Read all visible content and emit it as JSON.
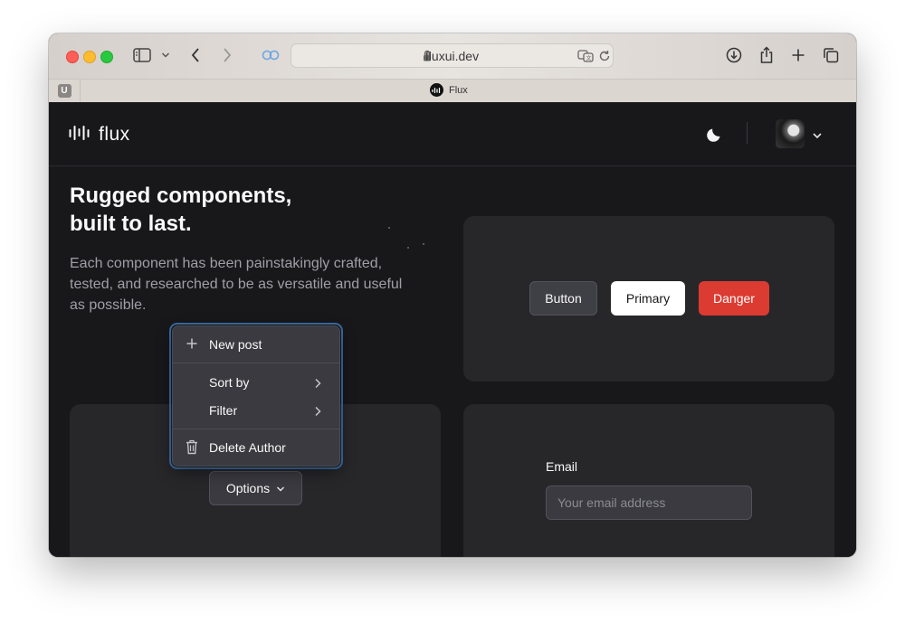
{
  "browser": {
    "url": "fluxui.dev",
    "pinned_tab_letter": "U",
    "tab_title": "Flux"
  },
  "header": {
    "logo_text": "flux"
  },
  "hero": {
    "title_line1": "Rugged components,",
    "title_line2": "built to last.",
    "description": "Each component has been painstakingly crafted, tested, and researched to be as versatile and useful as possible."
  },
  "buttons_card": {
    "default_label": "Button",
    "primary_label": "Primary",
    "danger_label": "Danger"
  },
  "dropdown": {
    "trigger_label": "Options",
    "items": [
      {
        "label": "New post",
        "icon": "plus-icon"
      },
      {
        "label": "Sort by",
        "icon": "chevron-right-icon"
      },
      {
        "label": "Filter",
        "icon": "chevron-right-icon"
      },
      {
        "label": "Delete Author",
        "icon": "trash-icon"
      }
    ]
  },
  "email_card": {
    "label": "Email",
    "placeholder": "Your email address"
  },
  "colors": {
    "page_bg": "#18181b",
    "card_bg": "#27272a",
    "danger": "#dc3b31",
    "focus_ring": "#3a6fa8"
  }
}
